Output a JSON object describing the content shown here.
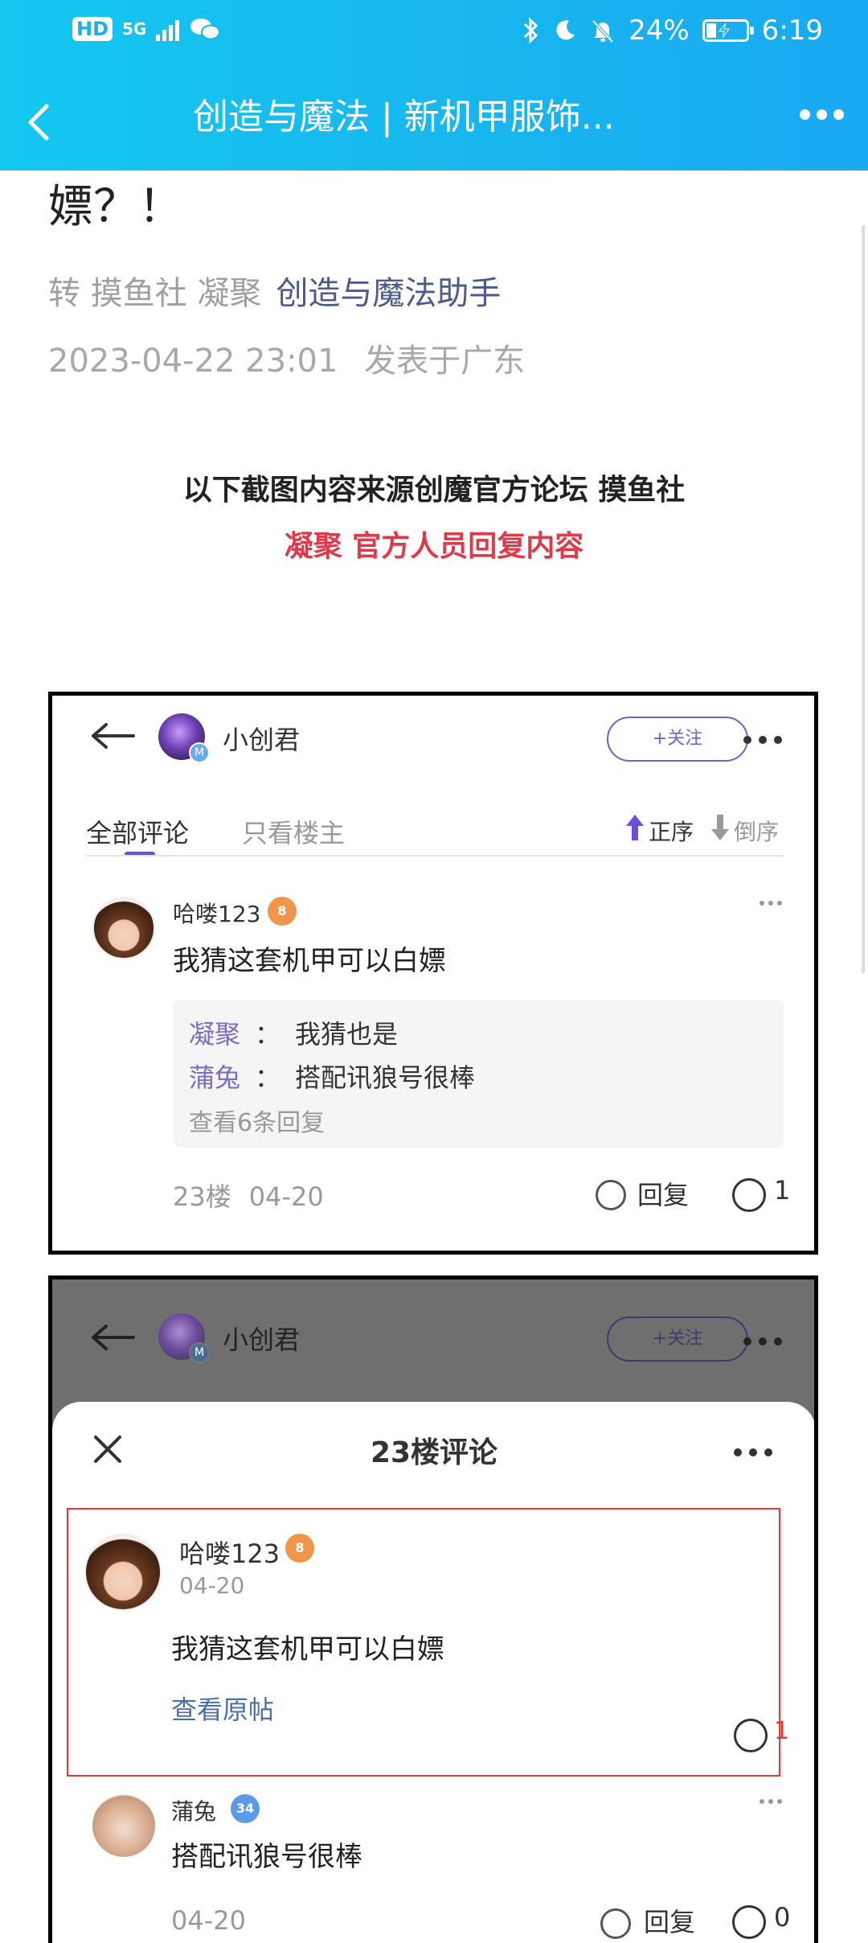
{
  "status_bar": {
    "left_hd": "HD",
    "left_net": "5G",
    "battery_percent": "24%",
    "battery_level": 0.24,
    "time": "6:19"
  },
  "nav": {
    "title": "创造与魔法 | 新机甲服饰..."
  },
  "article": {
    "headline": "嫖？！",
    "source_prefix": "转 摸鱼社 凝聚",
    "source_link": "创造与魔法助手",
    "date": "2023-04-22 23:01",
    "location": "发表于广东",
    "intro_line1": "以下截图内容来源创魔官方论坛 摸鱼社",
    "intro_line2": "凝聚 官方人员回复内容"
  },
  "shot1": {
    "user": "小创君",
    "badge": "M",
    "follow": "+关注",
    "tab_all": "全部评论",
    "tab_host": "只看楼主",
    "sort_asc": "正序",
    "sort_desc": "倒序",
    "comment": {
      "author": "哈喽123",
      "level": "8",
      "text": "我猜这套机甲可以白嫖",
      "replies": [
        {
          "name": "凝聚",
          "sep": "：",
          "text": "我猜也是"
        },
        {
          "name": "蒲兔",
          "sep": "：",
          "text": "搭配讯狼号很棒"
        }
      ],
      "view_more": "查看6条回复",
      "floor": "23楼",
      "date": "04-20",
      "reply_label": "回复",
      "likes": "1"
    }
  },
  "shot2": {
    "user": "小创君",
    "badge": "M",
    "follow": "+关注",
    "sheet_title": "23楼评论",
    "main": {
      "author": "哈喽123",
      "level": "8",
      "date": "04-20",
      "text": "我猜这套机甲可以白嫖",
      "view_original": "查看原帖",
      "likes": "1"
    },
    "reply": {
      "author": "蒲兔",
      "level": "34",
      "text": "搭配讯狼号很棒",
      "date": "04-20",
      "reply_label": "回复",
      "likes": "0"
    }
  }
}
